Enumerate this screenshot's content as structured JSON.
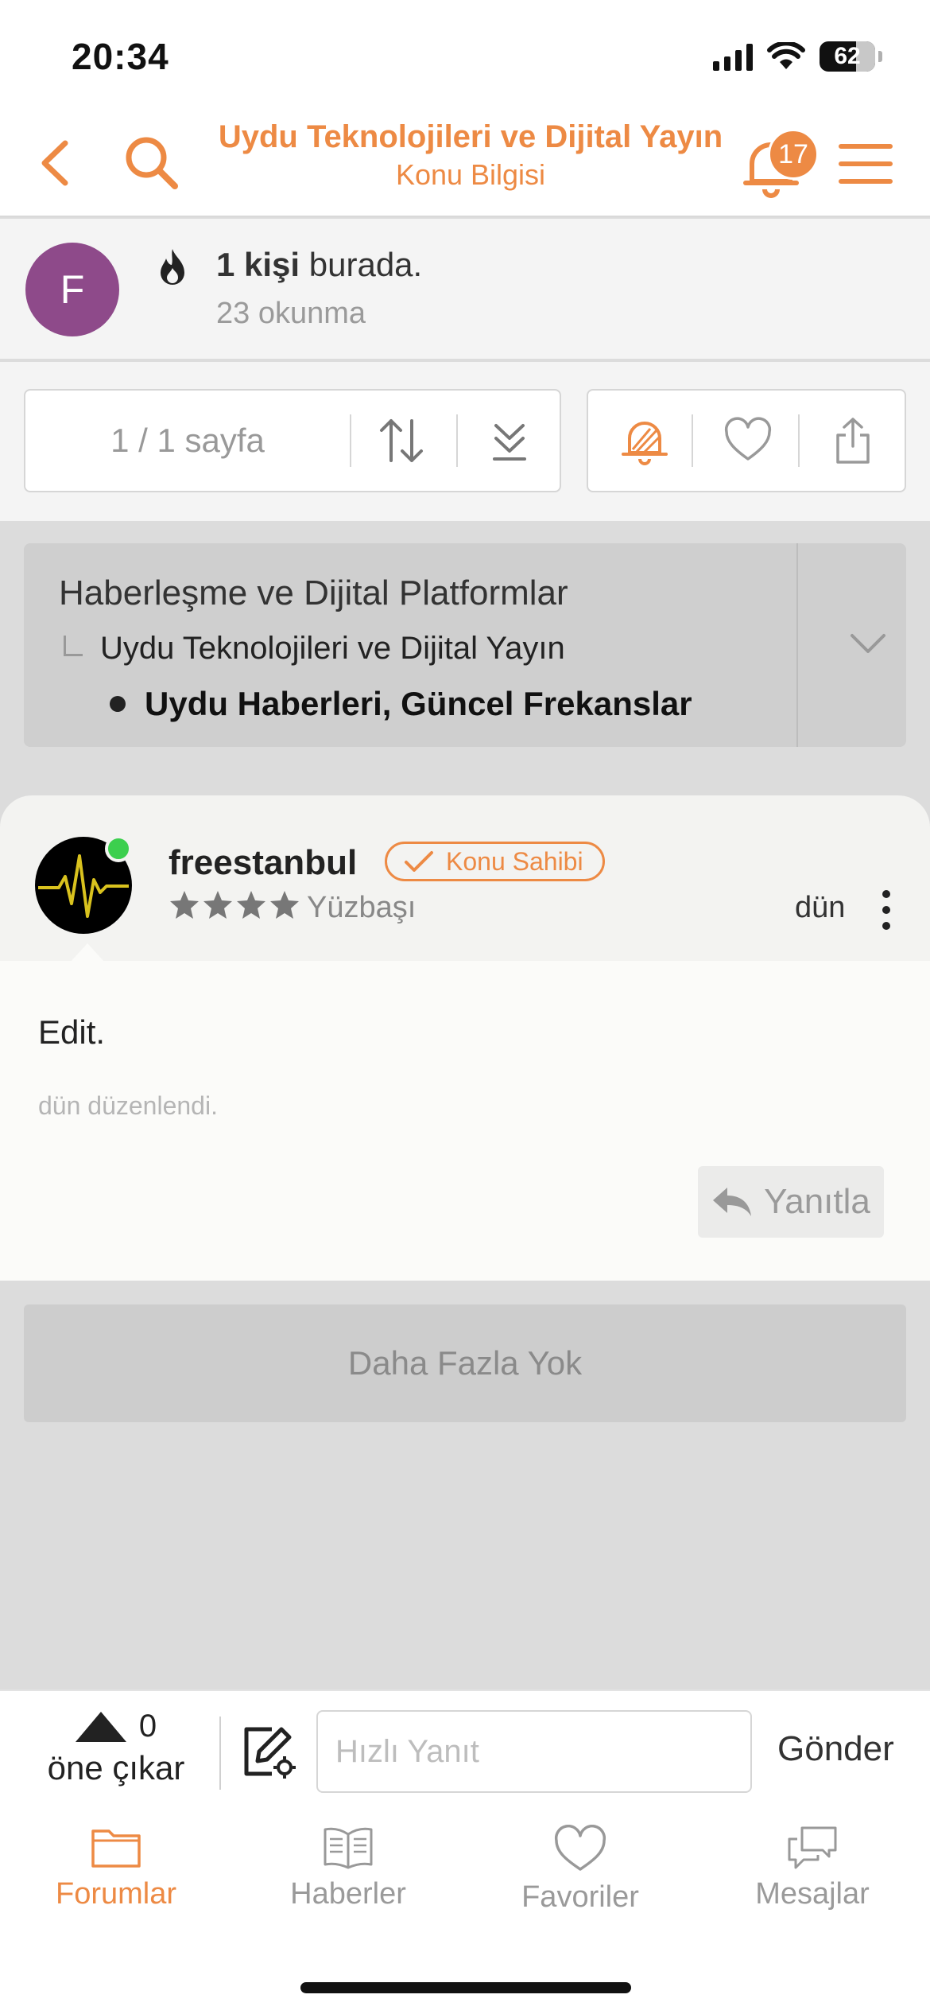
{
  "status": {
    "time": "20:34",
    "battery": "62"
  },
  "header": {
    "title": "Uydu Teknolojileri ve Dijital Yayın",
    "subtitle": "Konu Bilgisi",
    "notifications": "17"
  },
  "viewers": {
    "avatar_letter": "F",
    "count_bold": "1 kişi",
    "count_rest": " burada.",
    "reads": "23 okunma"
  },
  "toolbar": {
    "pages": "1 / 1 sayfa"
  },
  "breadcrumb": {
    "level1": "Haberleşme ve Dijital Platformlar",
    "level2": "Uydu Teknolojileri ve Dijital Yayın",
    "level3": "Uydu Haberleri, Güncel Frekanslar"
  },
  "post": {
    "username": "freestanbul",
    "owner_tag": "Konu Sahibi",
    "stars": 4,
    "rank": "Yüzbaşı",
    "time": "dün",
    "text": "Edit.",
    "edited": "dün düzenlendi.",
    "reply_label": "Yanıtla"
  },
  "no_more": "Daha Fazla Yok",
  "quick_reply": {
    "votes": "0",
    "vote_label": "öne çıkar",
    "placeholder": "Hızlı Yanıt",
    "send": "Gönder"
  },
  "tabs": [
    {
      "label": "Forumlar",
      "icon": "folder-icon",
      "active": true
    },
    {
      "label": "Haberler",
      "icon": "newspaper-icon",
      "active": false
    },
    {
      "label": "Favoriler",
      "icon": "heart-icon",
      "active": false
    },
    {
      "label": "Mesajlar",
      "icon": "chat-bubbles-icon",
      "active": false
    }
  ],
  "colors": {
    "accent": "#ed8a44",
    "avatar": "#8e4a8a",
    "online": "#3ccf4e"
  }
}
